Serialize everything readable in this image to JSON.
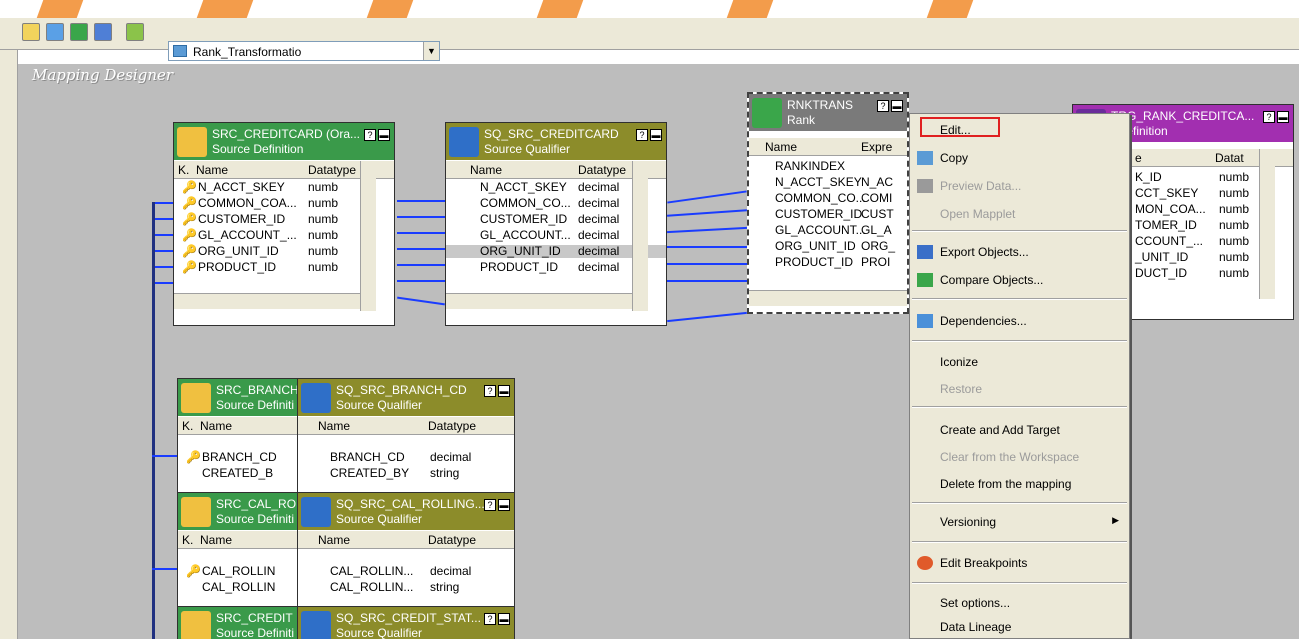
{
  "toolbar": {
    "icons": [
      "zoom-icon",
      "arrange-icon",
      "save-icon",
      "table-icon",
      "connect-icon"
    ],
    "mapping_select": "Rank_Transformatio"
  },
  "workspace_title": "Mapping Designer",
  "transformations": {
    "src_creditcard": {
      "title": "SRC_CREDITCARD (Ora...",
      "subtitle": "Source Definition",
      "columns": [
        "K.",
        "Name",
        "Datatype"
      ],
      "rows": [
        {
          "key": true,
          "name": "N_ACCT_SKEY",
          "type": "numb"
        },
        {
          "key": true,
          "name": "COMMON_COA...",
          "type": "numb"
        },
        {
          "key": true,
          "name": "CUSTOMER_ID",
          "type": "numb"
        },
        {
          "key": true,
          "name": "GL_ACCOUNT_...",
          "type": "numb"
        },
        {
          "key": true,
          "name": "ORG_UNIT_ID",
          "type": "numb"
        },
        {
          "key": true,
          "name": "PRODUCT_ID",
          "type": "numb"
        }
      ]
    },
    "sq_src_creditcard": {
      "title": "SQ_SRC_CREDITCARD",
      "subtitle": "Source Qualifier",
      "columns": [
        "Name",
        "Datatype"
      ],
      "rows": [
        {
          "name": "N_ACCT_SKEY",
          "type": "decimal"
        },
        {
          "name": "COMMON_CO...",
          "type": "decimal"
        },
        {
          "name": "CUSTOMER_ID",
          "type": "decimal"
        },
        {
          "name": "GL_ACCOUNT...",
          "type": "decimal"
        },
        {
          "name": "ORG_UNIT_ID",
          "type": "decimal"
        },
        {
          "name": "PRODUCT_ID",
          "type": "decimal"
        }
      ]
    },
    "rnktrans": {
      "title": "RNKTRANS",
      "subtitle": "Rank",
      "columns": [
        "Name",
        "Expre"
      ],
      "rows": [
        {
          "name": "RANKINDEX",
          "type": ""
        },
        {
          "name": "N_ACCT_SKEY",
          "type": "N_AC"
        },
        {
          "name": "COMMON_CO...",
          "type": "COMI"
        },
        {
          "name": "CUSTOMER_ID",
          "type": "CUST"
        },
        {
          "name": "GL_ACCOUNT...",
          "type": "GL_A"
        },
        {
          "name": "ORG_UNIT_ID",
          "type": "ORG_"
        },
        {
          "name": "PRODUCT_ID",
          "type": "PROI"
        }
      ]
    },
    "trg_rank": {
      "title": "TRG_RANK_CREDITCA...",
      "subtitle": "t Definition",
      "columns": [
        "e",
        "Datat"
      ],
      "rows": [
        {
          "name": "K_ID",
          "type": "numb"
        },
        {
          "name": "CCT_SKEY",
          "type": "numb"
        },
        {
          "name": "MON_COA...",
          "type": "numb"
        },
        {
          "name": "TOMER_ID",
          "type": "numb"
        },
        {
          "name": "CCOUNT_...",
          "type": "numb"
        },
        {
          "name": "_UNIT_ID",
          "type": "numb"
        },
        {
          "name": "DUCT_ID",
          "type": "numb"
        }
      ]
    },
    "src_branch": {
      "title": "SRC_BRANCH",
      "subtitle": "Source Definiti",
      "columns": [
        "K.",
        "Name"
      ],
      "rows": [
        {
          "key": true,
          "name": "BRANCH_CD"
        },
        {
          "key": false,
          "name": "CREATED_B"
        }
      ]
    },
    "sq_src_branch": {
      "title": "SQ_SRC_BRANCH_CD",
      "subtitle": "Source Qualifier",
      "columns": [
        "Name",
        "Datatype"
      ],
      "rows": [
        {
          "name": "BRANCH_CD",
          "type": "decimal"
        },
        {
          "name": "CREATED_BY",
          "type": "string"
        }
      ]
    },
    "src_cal": {
      "title": "SRC_CAL_RO",
      "subtitle": "Source Definiti",
      "columns": [
        "K.",
        "Name"
      ],
      "rows": [
        {
          "key": true,
          "name": "CAL_ROLLIN"
        },
        {
          "key": false,
          "name": "CAL_ROLLIN"
        }
      ]
    },
    "sq_src_cal": {
      "title": "SQ_SRC_CAL_ROLLING...",
      "subtitle": "Source Qualifier",
      "columns": [
        "Name",
        "Datatype"
      ],
      "rows": [
        {
          "name": "CAL_ROLLIN...",
          "type": "decimal"
        },
        {
          "name": "CAL_ROLLIN...",
          "type": "string"
        }
      ]
    },
    "src_credit_stat": {
      "title": "SRC_CREDIT",
      "subtitle": "Source Definiti"
    },
    "sq_src_credit_stat": {
      "title": "SQ_SRC_CREDIT_STAT...",
      "subtitle": "Source Qualifier"
    }
  },
  "context_menu": {
    "items": [
      {
        "label": "Edit...",
        "enabled": true,
        "icon": ""
      },
      {
        "label": "Copy",
        "enabled": true,
        "icon": "copy-icon"
      },
      {
        "label": "Preview Data...",
        "enabled": false,
        "icon": "preview-icon"
      },
      {
        "label": "Open Mapplet",
        "enabled": false,
        "icon": ""
      },
      {
        "label": "Export Objects...",
        "enabled": true,
        "icon": "export-icon"
      },
      {
        "label": "Compare Objects...",
        "enabled": true,
        "icon": "compare-icon"
      },
      {
        "label": "Dependencies...",
        "enabled": true,
        "icon": "dependencies-icon"
      },
      {
        "label": "Iconize",
        "enabled": true,
        "icon": ""
      },
      {
        "label": "Restore",
        "enabled": false,
        "icon": ""
      },
      {
        "label": "Create and Add Target",
        "enabled": true,
        "icon": ""
      },
      {
        "label": "Clear from the Workspace",
        "enabled": false,
        "icon": ""
      },
      {
        "label": "Delete from the mapping",
        "enabled": true,
        "icon": ""
      },
      {
        "label": "Versioning",
        "enabled": true,
        "icon": "",
        "submenu": true
      },
      {
        "label": "Edit Breakpoints",
        "enabled": true,
        "icon": "breakpoint-icon"
      },
      {
        "label": "Set options...",
        "enabled": true,
        "icon": ""
      },
      {
        "label": "Data Lineage",
        "enabled": true,
        "icon": ""
      }
    ]
  },
  "colors": {
    "source_header": "#3a9a4a",
    "qualifier_header": "#8c8c2a",
    "rank_header": "#7a7a7a",
    "target_header": "#a22fb0",
    "link": "#1a3cff",
    "highlight_box": "#e02020"
  }
}
